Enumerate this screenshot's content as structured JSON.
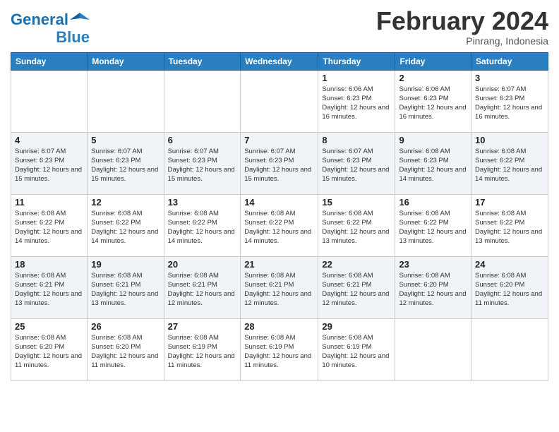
{
  "logo": {
    "line1": "General",
    "line2": "Blue"
  },
  "title": "February 2024",
  "subtitle": "Pinrang, Indonesia",
  "weekdays": [
    "Sunday",
    "Monday",
    "Tuesday",
    "Wednesday",
    "Thursday",
    "Friday",
    "Saturday"
  ],
  "weeks": [
    [
      {
        "day": "",
        "info": ""
      },
      {
        "day": "",
        "info": ""
      },
      {
        "day": "",
        "info": ""
      },
      {
        "day": "",
        "info": ""
      },
      {
        "day": "1",
        "info": "Sunrise: 6:06 AM\nSunset: 6:23 PM\nDaylight: 12 hours and 16 minutes."
      },
      {
        "day": "2",
        "info": "Sunrise: 6:06 AM\nSunset: 6:23 PM\nDaylight: 12 hours and 16 minutes."
      },
      {
        "day": "3",
        "info": "Sunrise: 6:07 AM\nSunset: 6:23 PM\nDaylight: 12 hours and 16 minutes."
      }
    ],
    [
      {
        "day": "4",
        "info": "Sunrise: 6:07 AM\nSunset: 6:23 PM\nDaylight: 12 hours and 15 minutes."
      },
      {
        "day": "5",
        "info": "Sunrise: 6:07 AM\nSunset: 6:23 PM\nDaylight: 12 hours and 15 minutes."
      },
      {
        "day": "6",
        "info": "Sunrise: 6:07 AM\nSunset: 6:23 PM\nDaylight: 12 hours and 15 minutes."
      },
      {
        "day": "7",
        "info": "Sunrise: 6:07 AM\nSunset: 6:23 PM\nDaylight: 12 hours and 15 minutes."
      },
      {
        "day": "8",
        "info": "Sunrise: 6:07 AM\nSunset: 6:23 PM\nDaylight: 12 hours and 15 minutes."
      },
      {
        "day": "9",
        "info": "Sunrise: 6:08 AM\nSunset: 6:23 PM\nDaylight: 12 hours and 14 minutes."
      },
      {
        "day": "10",
        "info": "Sunrise: 6:08 AM\nSunset: 6:22 PM\nDaylight: 12 hours and 14 minutes."
      }
    ],
    [
      {
        "day": "11",
        "info": "Sunrise: 6:08 AM\nSunset: 6:22 PM\nDaylight: 12 hours and 14 minutes."
      },
      {
        "day": "12",
        "info": "Sunrise: 6:08 AM\nSunset: 6:22 PM\nDaylight: 12 hours and 14 minutes."
      },
      {
        "day": "13",
        "info": "Sunrise: 6:08 AM\nSunset: 6:22 PM\nDaylight: 12 hours and 14 minutes."
      },
      {
        "day": "14",
        "info": "Sunrise: 6:08 AM\nSunset: 6:22 PM\nDaylight: 12 hours and 14 minutes."
      },
      {
        "day": "15",
        "info": "Sunrise: 6:08 AM\nSunset: 6:22 PM\nDaylight: 12 hours and 13 minutes."
      },
      {
        "day": "16",
        "info": "Sunrise: 6:08 AM\nSunset: 6:22 PM\nDaylight: 12 hours and 13 minutes."
      },
      {
        "day": "17",
        "info": "Sunrise: 6:08 AM\nSunset: 6:22 PM\nDaylight: 12 hours and 13 minutes."
      }
    ],
    [
      {
        "day": "18",
        "info": "Sunrise: 6:08 AM\nSunset: 6:21 PM\nDaylight: 12 hours and 13 minutes."
      },
      {
        "day": "19",
        "info": "Sunrise: 6:08 AM\nSunset: 6:21 PM\nDaylight: 12 hours and 13 minutes."
      },
      {
        "day": "20",
        "info": "Sunrise: 6:08 AM\nSunset: 6:21 PM\nDaylight: 12 hours and 12 minutes."
      },
      {
        "day": "21",
        "info": "Sunrise: 6:08 AM\nSunset: 6:21 PM\nDaylight: 12 hours and 12 minutes."
      },
      {
        "day": "22",
        "info": "Sunrise: 6:08 AM\nSunset: 6:21 PM\nDaylight: 12 hours and 12 minutes."
      },
      {
        "day": "23",
        "info": "Sunrise: 6:08 AM\nSunset: 6:20 PM\nDaylight: 12 hours and 12 minutes."
      },
      {
        "day": "24",
        "info": "Sunrise: 6:08 AM\nSunset: 6:20 PM\nDaylight: 12 hours and 11 minutes."
      }
    ],
    [
      {
        "day": "25",
        "info": "Sunrise: 6:08 AM\nSunset: 6:20 PM\nDaylight: 12 hours and 11 minutes."
      },
      {
        "day": "26",
        "info": "Sunrise: 6:08 AM\nSunset: 6:20 PM\nDaylight: 12 hours and 11 minutes."
      },
      {
        "day": "27",
        "info": "Sunrise: 6:08 AM\nSunset: 6:19 PM\nDaylight: 12 hours and 11 minutes."
      },
      {
        "day": "28",
        "info": "Sunrise: 6:08 AM\nSunset: 6:19 PM\nDaylight: 12 hours and 11 minutes."
      },
      {
        "day": "29",
        "info": "Sunrise: 6:08 AM\nSunset: 6:19 PM\nDaylight: 12 hours and 10 minutes."
      },
      {
        "day": "",
        "info": ""
      },
      {
        "day": "",
        "info": ""
      }
    ]
  ]
}
